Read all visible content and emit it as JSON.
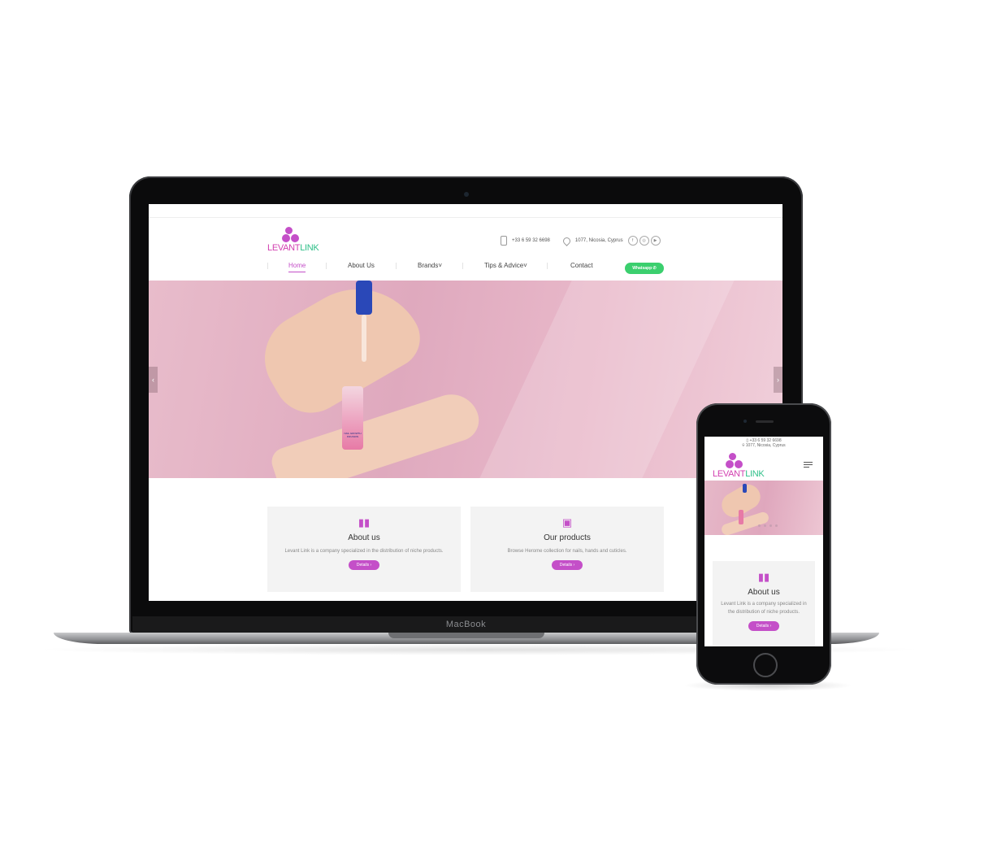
{
  "laptop": {
    "brand": "MacBook"
  },
  "site": {
    "logo": {
      "part1": "LEVANT",
      "part2": "LINK"
    },
    "contact": {
      "phone": "+33 6 59 32 6698",
      "address": "1077, Nicosia, Cyprus"
    },
    "social": [
      "f",
      "◎",
      "▶"
    ],
    "nav": [
      {
        "label": "Home"
      },
      {
        "label": "About Us"
      },
      {
        "label": "Brands"
      },
      {
        "label": "Tips & Advice"
      },
      {
        "label": "Contact"
      }
    ],
    "whatsapp_label": "Whatsapp",
    "hero": {
      "prev": "‹",
      "next": "›",
      "bottle_label": "NAIL GROWTH INFUSION"
    },
    "cards": [
      {
        "icon": "book-icon",
        "title": "About us",
        "text": "Levant Link is a company specialized in the distribution of niche products.",
        "button": "Details  ›"
      },
      {
        "icon": "images-icon",
        "title": "Our products",
        "text": "Browse Herome collection for nails, hands and cuticles.",
        "button": "Details  ›"
      }
    ]
  },
  "mobile": {
    "phone": "+33 6 59 32 6698",
    "address": "1077, Nicosia, Cyprus",
    "logo": {
      "part1": "LEVANT",
      "part2": "LINK"
    },
    "card": {
      "title": "About us",
      "text": "Levant Link is a company specialized in the distribution of niche products.",
      "button": "Details  ›"
    }
  },
  "colors": {
    "accent": "#c44fc8",
    "green": "#2fbf88",
    "whatsapp": "#3bcf6e",
    "hero_pink": "#e2adc1"
  }
}
